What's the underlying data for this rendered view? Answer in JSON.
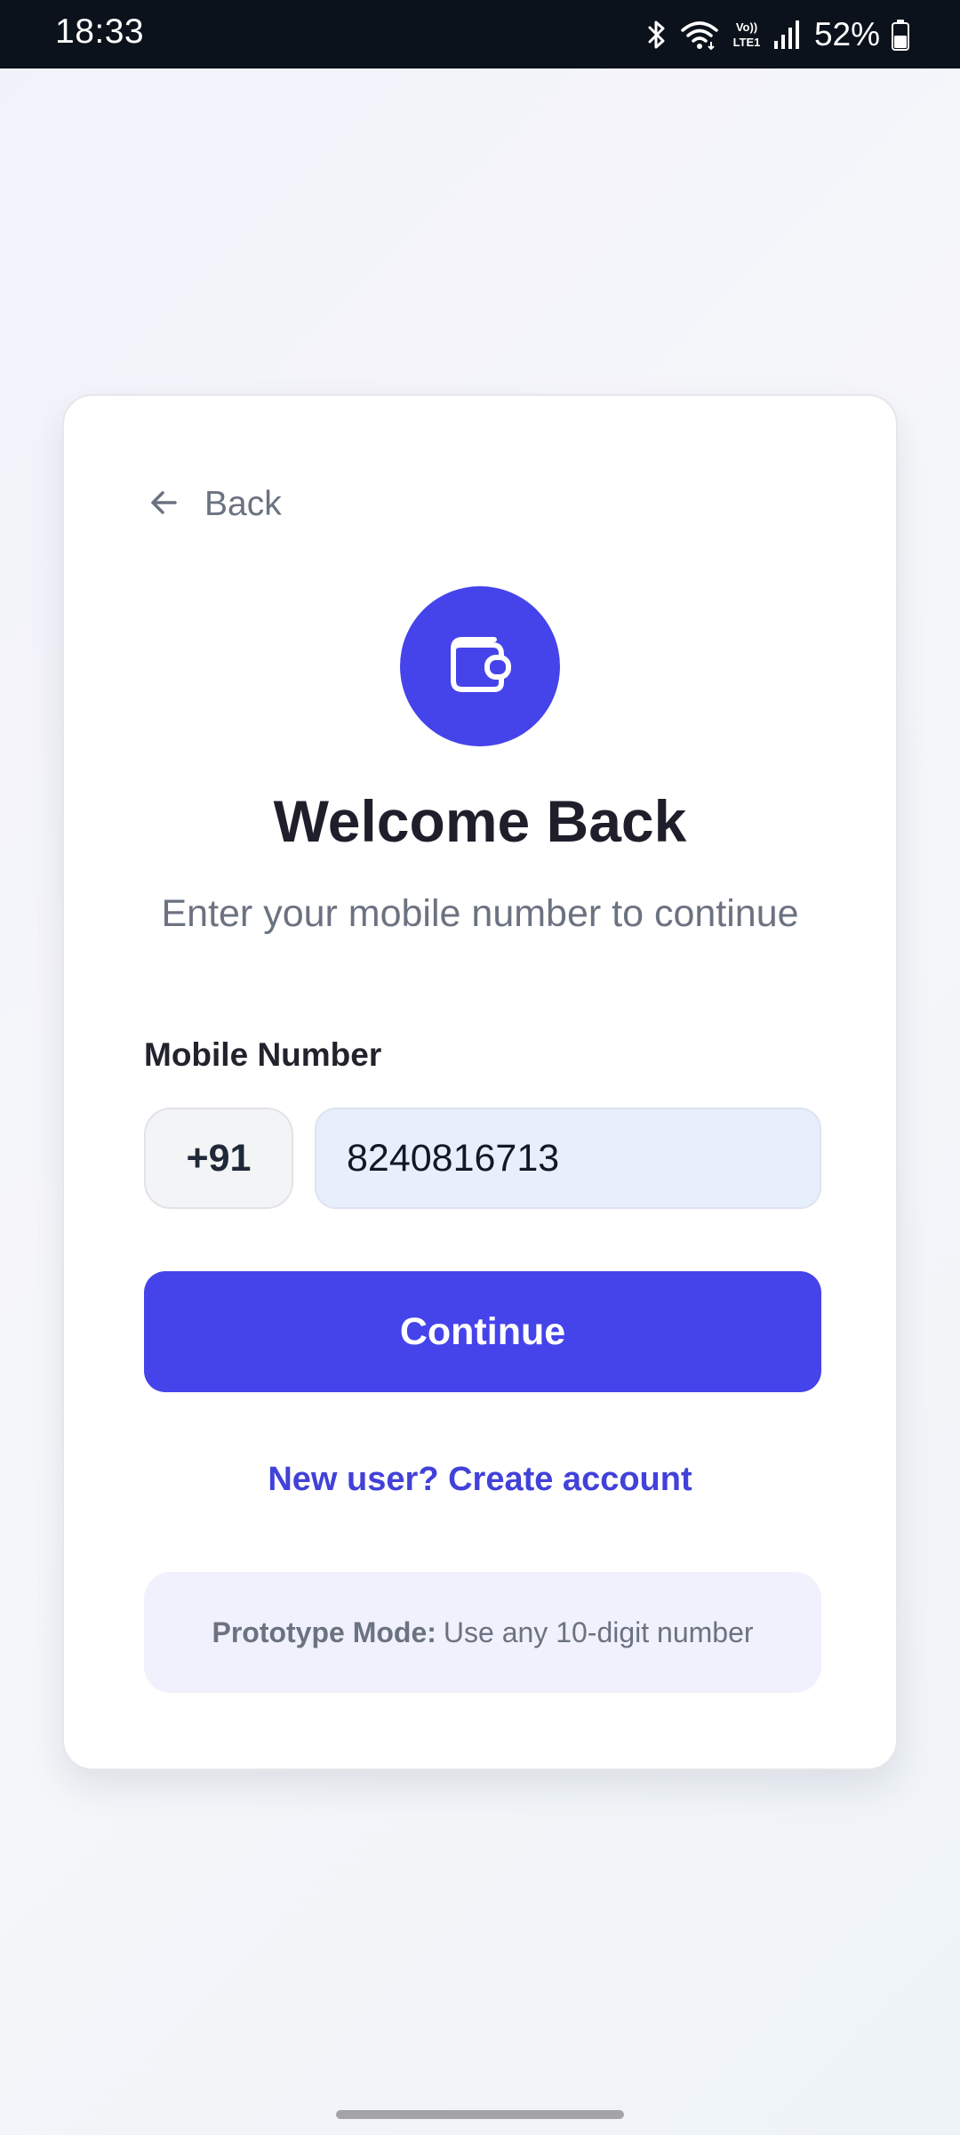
{
  "status_bar": {
    "time": "18:33",
    "network_label": "Vo) LTE1",
    "battery_percent": "52%",
    "icons": [
      "bluetooth-icon",
      "wifi-icon",
      "volte-icon",
      "signal-icon",
      "battery-icon"
    ]
  },
  "card": {
    "back_label": "Back",
    "logo_icon": "wallet-icon",
    "title": "Welcome Back",
    "subtitle": "Enter your mobile number to continue",
    "field_label": "Mobile Number",
    "country_code": "+91",
    "phone_value": "8240816713",
    "continue_label": "Continue",
    "create_account_label": "New user? Create account",
    "notice": {
      "strong": "Prototype Mode:",
      "text": "Use any 10-digit number"
    }
  },
  "colors": {
    "accent": "#4543ea",
    "link": "#4241d9",
    "status_bar_bg": "#0c121b",
    "input_bg": "#e8effc",
    "notice_bg": "#f0f1fd"
  }
}
